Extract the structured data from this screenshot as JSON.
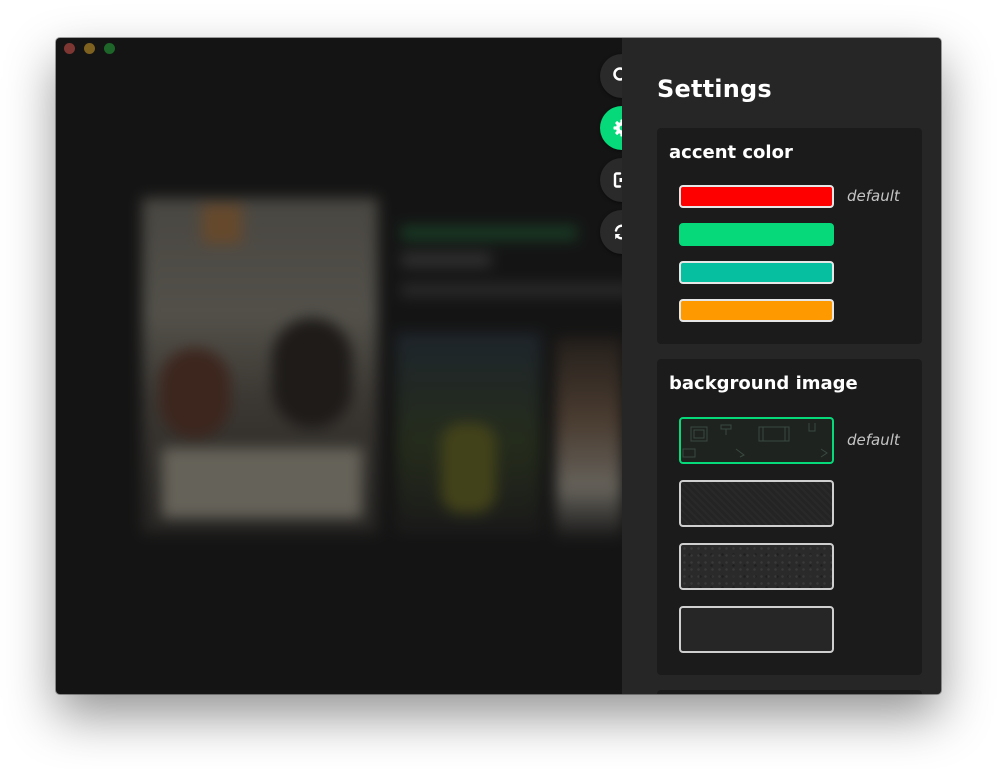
{
  "window": {
    "controls": [
      "close",
      "minimize",
      "zoom"
    ]
  },
  "rail": [
    {
      "icon": "search-icon",
      "active": false
    },
    {
      "icon": "gear-icon",
      "active": true
    },
    {
      "icon": "logout-icon",
      "active": false
    },
    {
      "icon": "refresh-icon",
      "active": false
    }
  ],
  "settings": {
    "title": "Settings",
    "accent": {
      "title": "accent color",
      "swatches": [
        {
          "color": "#fe0000",
          "label": "default",
          "selected": false
        },
        {
          "color": "#05d97a",
          "label": "",
          "selected": true
        },
        {
          "color": "#05bfa0",
          "label": "",
          "selected": false
        },
        {
          "color": "#ff9900",
          "label": "",
          "selected": false
        }
      ]
    },
    "background": {
      "title": "background image",
      "images": [
        {
          "name": "doodle-pattern",
          "label": "default",
          "selected": true
        },
        {
          "name": "dark-weave",
          "label": "",
          "selected": false
        },
        {
          "name": "concrete",
          "label": "",
          "selected": false
        },
        {
          "name": "plain-dark",
          "label": "",
          "selected": false
        }
      ]
    }
  },
  "colors": {
    "accent": "#05d97a",
    "panel": "#262626",
    "card": "#1b1b1b"
  }
}
